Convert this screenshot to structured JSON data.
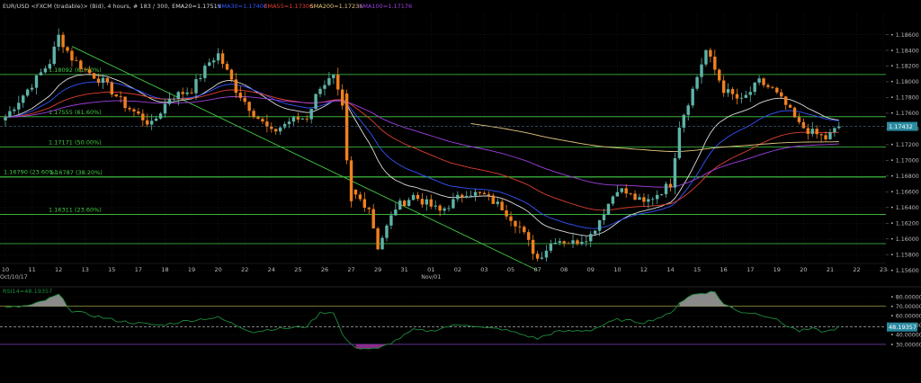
{
  "header": {
    "symbol": "EUR/USD <FXCM (tradable)> (Bid), 4 hours, # 183 / 300, ",
    "indicators": [
      {
        "label": "EMA20=1.17519",
        "color": "#dddddd"
      },
      {
        "label": "EMA30=1.17400",
        "color": "#3355ff"
      },
      {
        "label": "EMA55=1.17306",
        "color": "#e04030"
      },
      {
        "label": "SMA200=1.17236",
        "color": "#e8c880"
      },
      {
        "label": "EMA100=1.17176",
        "color": "#a040e0"
      }
    ]
  },
  "colors": {
    "background": "#000000",
    "bull_candle": "#5fb3a8",
    "bear_candle": "#f08020",
    "fib_line": "#44cc44",
    "grid": "#1c1c1c",
    "axis_text": "#bbbbbb",
    "price_tag": "#2a8aa0",
    "rsi_line": "#1e8a3c",
    "rsi_band_upper": "#9a9a40",
    "rsi_band_lower": "#8040c0"
  },
  "chart_data": [
    {
      "type": "candlestick",
      "title": "EUR/USD <FXCM (tradable)> (Bid), 4 hours",
      "ylim": [
        1.157,
        1.1888
      ],
      "y_ticks": [
        "1.18600",
        "1.18400",
        "1.18200",
        "1.18000",
        "1.17800",
        "1.17600",
        "1.17400",
        "1.17200",
        "1.17000",
        "1.16800",
        "1.16600",
        "1.16400",
        "1.16200",
        "1.16000",
        "1.15800",
        "1.15600"
      ],
      "y_tick_values": [
        1.186,
        1.184,
        1.182,
        1.18,
        1.178,
        1.176,
        1.174,
        1.172,
        1.17,
        1.168,
        1.166,
        1.164,
        1.162,
        1.16,
        1.158,
        1.156
      ],
      "x_ticks": [
        "10",
        "11",
        "12",
        "13",
        "15",
        "17",
        "18",
        "19",
        "20",
        "22",
        "24",
        "25",
        "26",
        "27",
        "29",
        "31",
        "01",
        "02",
        "03",
        "05",
        "07",
        "08",
        "09",
        "10",
        "12",
        "14",
        "15",
        "16",
        "17",
        "19",
        "20",
        "21",
        "22",
        "23"
      ],
      "x_tick_bar_index": [
        0,
        6,
        12,
        18,
        24,
        30,
        36,
        42,
        48,
        54,
        60,
        66,
        72,
        78,
        84,
        90,
        96,
        102,
        108,
        114,
        120,
        126,
        132,
        138,
        144,
        150,
        156,
        162,
        168,
        174,
        180,
        186,
        192,
        198
      ],
      "x_sublabels": [
        {
          "text": "Oct/10/17",
          "bar_index": 0
        },
        {
          "text": "Nov/01",
          "bar_index": 96
        }
      ],
      "current_price": "1.17432",
      "current_price_value": 1.17432,
      "fib_levels": [
        {
          "label": "1.18092 (61.60%)",
          "value": 1.18092
        },
        {
          "label": "1.17555 (61.60%)",
          "value": 1.17555
        },
        {
          "label": "1.17171 (50.00%)",
          "value": 1.17171
        },
        {
          "label": "1.16790 (23.60%)",
          "value": 1.1679
        },
        {
          "label": "1.16787 (38.20%)",
          "value": 1.16787
        },
        {
          "label": "1.16311 (23.60%)",
          "value": 1.16311
        },
        {
          "label": "",
          "value": 1.1594
        }
      ],
      "trendline": {
        "from": {
          "bar_index": 15,
          "price": 1.1845
        },
        "to": {
          "bar_index": 120,
          "price": 1.156
        }
      },
      "waypoints": [
        [
          0,
          1.1755
        ],
        [
          10,
          1.1825
        ],
        [
          12,
          1.1858
        ],
        [
          15,
          1.183
        ],
        [
          18,
          1.1815
        ],
        [
          22,
          1.18
        ],
        [
          27,
          1.177
        ],
        [
          33,
          1.1745
        ],
        [
          37,
          1.178
        ],
        [
          42,
          1.179
        ],
        [
          46,
          1.1825
        ],
        [
          48,
          1.1835
        ],
        [
          52,
          1.179
        ],
        [
          56,
          1.176
        ],
        [
          60,
          1.1735
        ],
        [
          64,
          1.175
        ],
        [
          68,
          1.1755
        ],
        [
          71,
          1.1795
        ],
        [
          74,
          1.1805
        ],
        [
          76,
          1.1765
        ],
        [
          78,
          1.166
        ],
        [
          82,
          1.164
        ],
        [
          84,
          1.159
        ],
        [
          88,
          1.164
        ],
        [
          92,
          1.1655
        ],
        [
          98,
          1.1635
        ],
        [
          104,
          1.166
        ],
        [
          108,
          1.1655
        ],
        [
          112,
          1.164
        ],
        [
          116,
          1.1615
        ],
        [
          120,
          1.1575
        ],
        [
          124,
          1.16
        ],
        [
          128,
          1.1595
        ],
        [
          132,
          1.1605
        ],
        [
          138,
          1.1665
        ],
        [
          144,
          1.1645
        ],
        [
          150,
          1.167
        ],
        [
          152,
          1.1745
        ],
        [
          155,
          1.179
        ],
        [
          158,
          1.184
        ],
        [
          162,
          1.179
        ],
        [
          166,
          1.1775
        ],
        [
          170,
          1.18
        ],
        [
          173,
          1.179
        ],
        [
          176,
          1.177
        ],
        [
          179,
          1.1745
        ],
        [
          182,
          1.1735
        ],
        [
          185,
          1.1728
        ],
        [
          188,
          1.1743
        ]
      ]
    },
    {
      "type": "line",
      "title": "RSI14=48.19357",
      "ylim": [
        20,
        90
      ],
      "y_ticks": [
        "80.00000",
        "70.00000",
        "60.00000",
        "50.00000",
        "40.00000",
        "30.00000"
      ],
      "y_tick_values": [
        80,
        70,
        60,
        50,
        40,
        30
      ],
      "bands": [
        70,
        30
      ],
      "current_value": "48.19357",
      "current_value_num": 48.19,
      "waypoints": [
        [
          0,
          68
        ],
        [
          6,
          71
        ],
        [
          10,
          78
        ],
        [
          12,
          82
        ],
        [
          15,
          65
        ],
        [
          20,
          60
        ],
        [
          25,
          55
        ],
        [
          30,
          52
        ],
        [
          35,
          50
        ],
        [
          40,
          54
        ],
        [
          45,
          57
        ],
        [
          48,
          58
        ],
        [
          52,
          50
        ],
        [
          56,
          43
        ],
        [
          60,
          46
        ],
        [
          64,
          47
        ],
        [
          68,
          49
        ],
        [
          71,
          63
        ],
        [
          74,
          64
        ],
        [
          76,
          40
        ],
        [
          78,
          29
        ],
        [
          80,
          26
        ],
        [
          84,
          25
        ],
        [
          88,
          34
        ],
        [
          92,
          45
        ],
        [
          96,
          44
        ],
        [
          100,
          49
        ],
        [
          104,
          51
        ],
        [
          108,
          47
        ],
        [
          112,
          46
        ],
        [
          116,
          41
        ],
        [
          120,
          36
        ],
        [
          124,
          43
        ],
        [
          128,
          44
        ],
        [
          132,
          45
        ],
        [
          138,
          56
        ],
        [
          144,
          53
        ],
        [
          150,
          62
        ],
        [
          152,
          74
        ],
        [
          155,
          82
        ],
        [
          157,
          84
        ],
        [
          160,
          85
        ],
        [
          162,
          72
        ],
        [
          166,
          64
        ],
        [
          170,
          62
        ],
        [
          173,
          58
        ],
        [
          176,
          50
        ],
        [
          179,
          44
        ],
        [
          182,
          46
        ],
        [
          185,
          43
        ],
        [
          188,
          48
        ]
      ]
    }
  ]
}
